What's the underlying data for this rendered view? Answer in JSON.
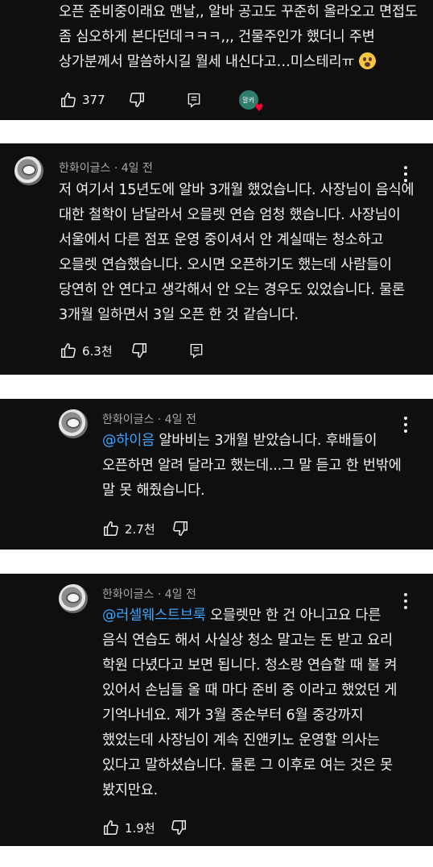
{
  "comments": [
    {
      "text": "오픈 준비중이래요 맨날,, 알바 공고도 꾸준히 올라오고 면접도\n좀 심오하게 본다던데ㅋㅋㅋ,,, 건물주인가 했더니 주변\n상가분께서 말씀하시길 월세 내신다고…미스테리ㅠ",
      "emoji_icon": "astonished-face-emoji",
      "likes": "377",
      "heart_badge_label": "말카",
      "heart": "♥"
    },
    {
      "author": "한화이글스",
      "time": "4일 전",
      "text": "저 여기서 15년도에 알바 3개월 했었습니다. 사장님이 음식에\n대한 철학이 남달라서 오믈렛 연습 엄청 했습니다. 사장님이\n서울에서 다른 점포 운영 중이셔서 안 계실때는 청소하고\n오믈렛 연습했습니다. 오시면 오픈하기도 했는데 사람들이\n당연히 안 연다고 생각해서 안 오는 경우도 있었습니다. 물론\n3개월 일하면서 3일 오픈 한 것 같습니다.",
      "likes": "6.3천"
    },
    {
      "author": "한화이글스",
      "time": "4일 전",
      "mention": "@하이음",
      "text": " 알바비는 3개월 받았습니다. 후배들이\n오픈하면 알려 달라고 했는데...그 말 듣고 한 번밖에\n말 못 해줬습니다.",
      "likes": "2.7천"
    },
    {
      "author": "한화이글스",
      "time": "4일 전",
      "mention": "@러셀웨스트브룩",
      "text": "  오믈렛만 한 건 아니고요 다른\n음식 연습도 해서 사실상 청소 말고는 돈 받고 요리\n학원 다녔다고 보면 됩니다. 청소랑 연습할 때 불 켜\n있어서 손님들 올 때 마다 준비 중 이라고 했었던 게\n기억나네요. 제가 3월 중순부터 6월 중강까지\n했었는데 사장님이 계속 진앤키노 운영할 의사는\n있다고 말하셨습니다. 물론 그 이후로 여는 것은 못\n봤지만요.",
      "likes": "1.9천"
    }
  ],
  "meta_separator": " · ",
  "colors": {
    "background": "#0f0f0f",
    "text": "#f1f1f1",
    "meta": "#aaaaaa",
    "mention": "#3ea6ff",
    "separator": "#ffffff"
  },
  "icons": [
    "thumbs-up-icon",
    "thumbs-down-icon",
    "reply-icon",
    "more-vert-icon",
    "heart-icon"
  ]
}
